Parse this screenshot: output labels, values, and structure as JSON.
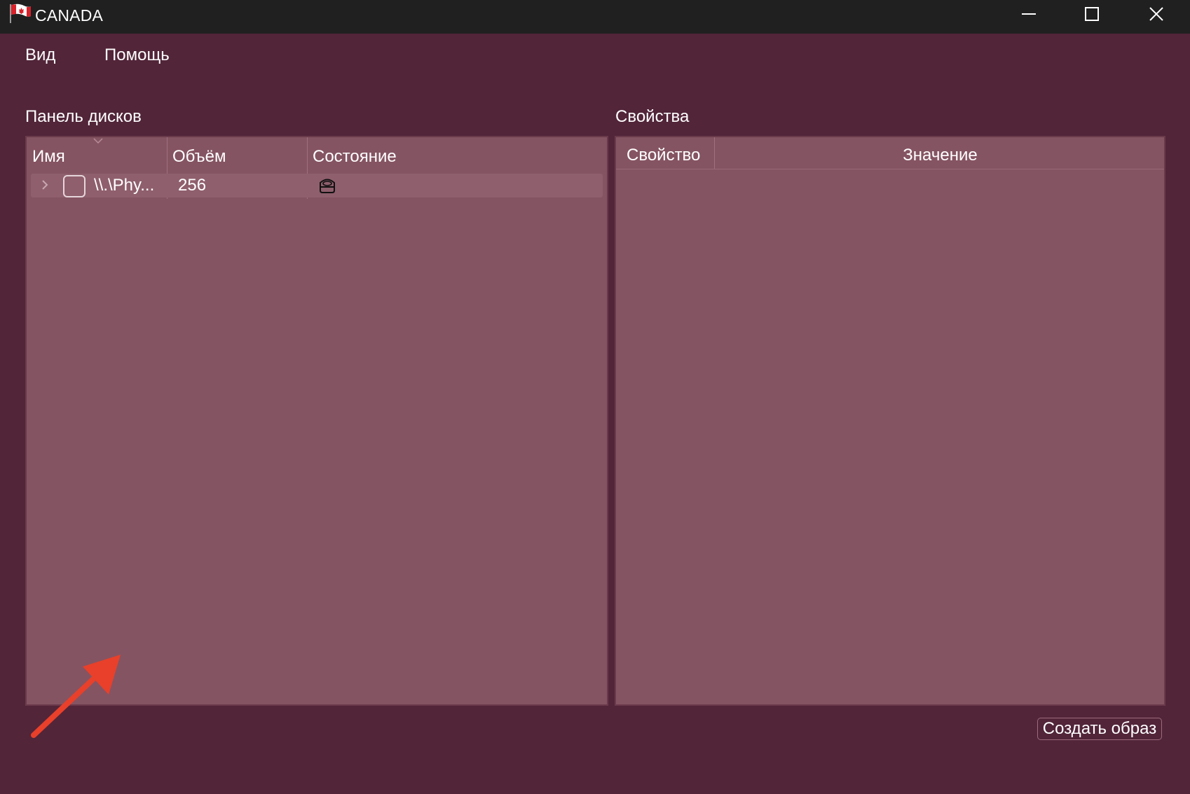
{
  "window": {
    "title": "CANADA",
    "icon": "canada-flag-icon",
    "controls": [
      "minimize-icon",
      "maximize-icon",
      "close-icon"
    ]
  },
  "menu": {
    "items": [
      {
        "label": "Вид"
      },
      {
        "label": "Помощь"
      }
    ]
  },
  "disks_panel": {
    "label": "Панель дисков",
    "columns": [
      "Имя",
      "Объём",
      "Состояние"
    ],
    "sorted_column": "Имя",
    "rows": [
      {
        "expander_icon": "chevron-right-icon",
        "checked": false,
        "name": "\\\\.\\Phy...",
        "size": "256",
        "status_icon": "disk-drive-icon"
      }
    ]
  },
  "properties_panel": {
    "label": "Свойства",
    "columns": [
      "Свойство",
      "Значение"
    ],
    "rows": []
  },
  "actions": {
    "create_image_label": "Создать образ"
  },
  "colors": {
    "window_background": "#522539",
    "titlebar_background": "#202020",
    "panel_background": "#855462",
    "row_background": "#8f5f6d",
    "annotation_arrow": "#e8402a"
  }
}
